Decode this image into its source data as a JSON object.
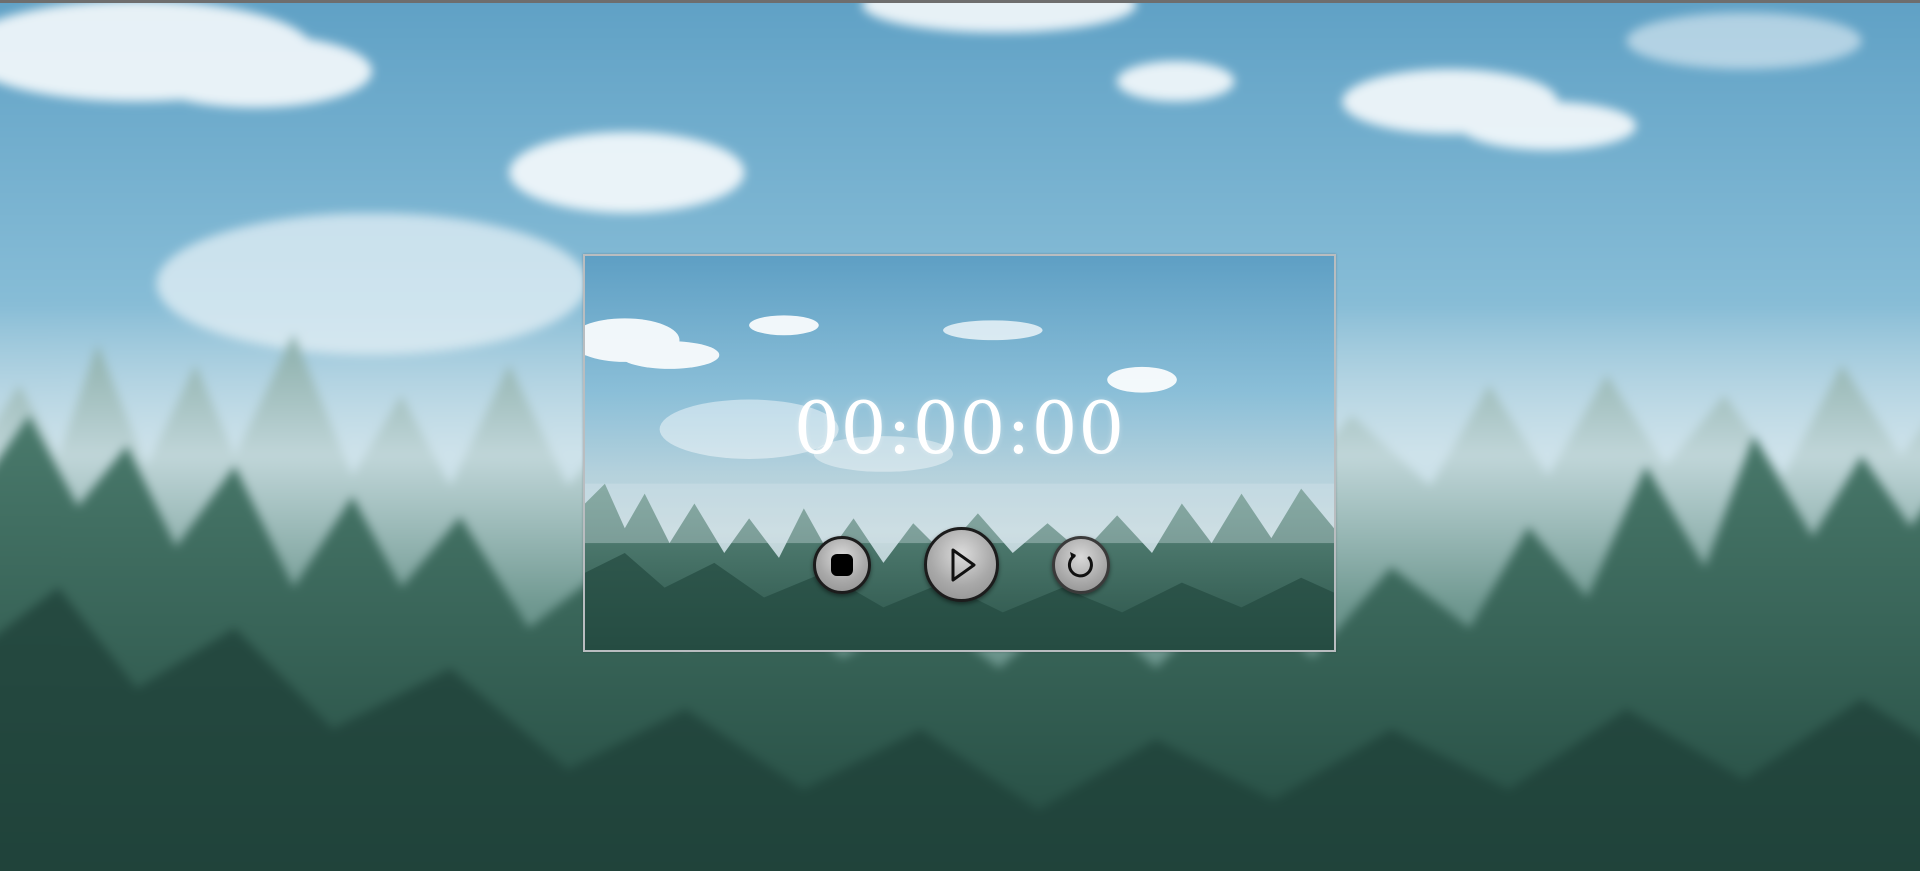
{
  "stopwatch": {
    "time": "00:00:00",
    "stop_icon": "stop-icon",
    "play_icon": "play-icon",
    "reset_icon": "reset-icon"
  },
  "colors": {
    "sky_top": "#5fa3c7",
    "sky_mid": "#9ccbe0",
    "mist": "#c9dde6",
    "forest_dark": "#2d5a4f",
    "forest_mid": "#4b7a6e",
    "digits": "#ffffff",
    "button_fill": "#a9a9a9",
    "button_ring": "#1c1c1c"
  }
}
